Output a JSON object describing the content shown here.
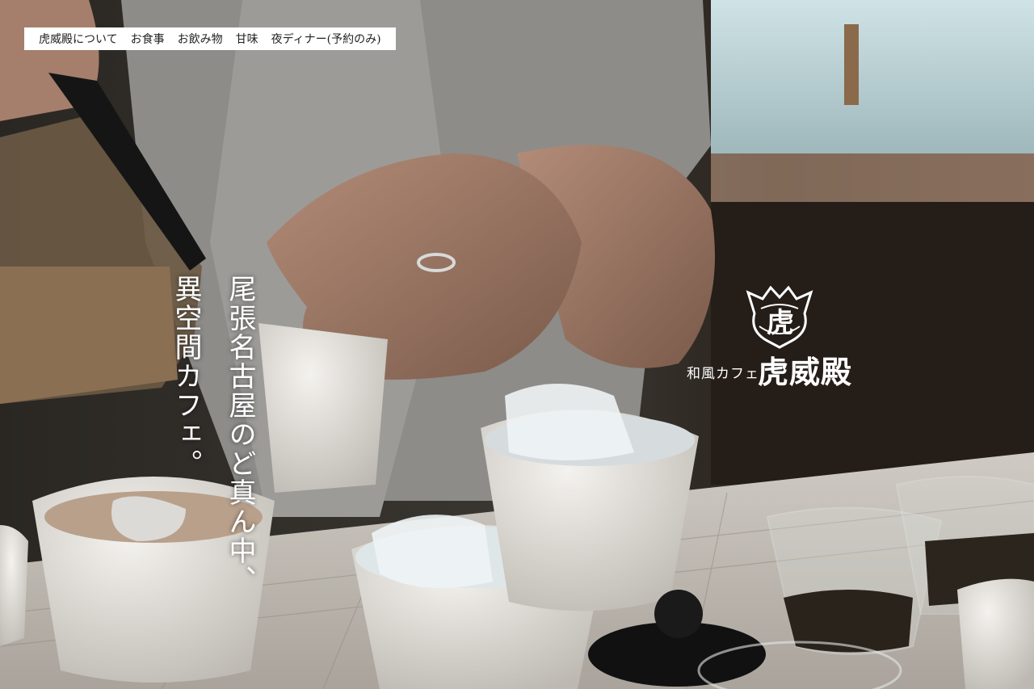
{
  "nav": {
    "items": [
      {
        "label": "虎威殿について"
      },
      {
        "label": "お食事"
      },
      {
        "label": "お飲み物"
      },
      {
        "label": "甘味"
      },
      {
        "label": "夜ディナー(予約のみ)"
      }
    ]
  },
  "tagline": {
    "line1": "尾張名古屋のど真ん中、",
    "line2": "異空間カフェ。"
  },
  "logo": {
    "emblem_char": "虎",
    "subtitle": "和風カフェ",
    "name": "虎威殿"
  },
  "colors": {
    "nav_bg": "#ffffff",
    "text_light": "#ffffff",
    "bg_dark": "#1b1a18"
  },
  "icons": {
    "logo_emblem": "tiger-emblem-icon"
  }
}
